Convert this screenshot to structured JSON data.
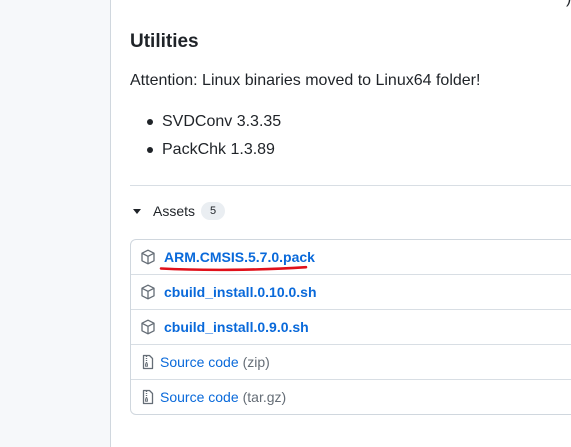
{
  "top_fragment": ")",
  "heading": "Utilities",
  "attention": "Attention: Linux binaries moved to Linux64 folder!",
  "bullets": [
    "SVDConv 3.3.35",
    "PackChk 1.3.89"
  ],
  "assets": {
    "label": "Assets",
    "count": "5",
    "files": [
      {
        "name": "ARM.CMSIS.5.7.0.pack",
        "icon": "package-icon"
      },
      {
        "name": "cbuild_install.0.10.0.sh",
        "icon": "package-icon"
      },
      {
        "name": "cbuild_install.0.9.0.sh",
        "icon": "package-icon"
      }
    ],
    "sources": [
      {
        "label": "Source code",
        "ext": "(zip)",
        "icon": "file-zip-icon"
      },
      {
        "label": "Source code",
        "ext": "(tar.gz)",
        "icon": "file-zip-icon"
      }
    ]
  },
  "annotation_color": "#e0101a",
  "link_color": "#0969da"
}
